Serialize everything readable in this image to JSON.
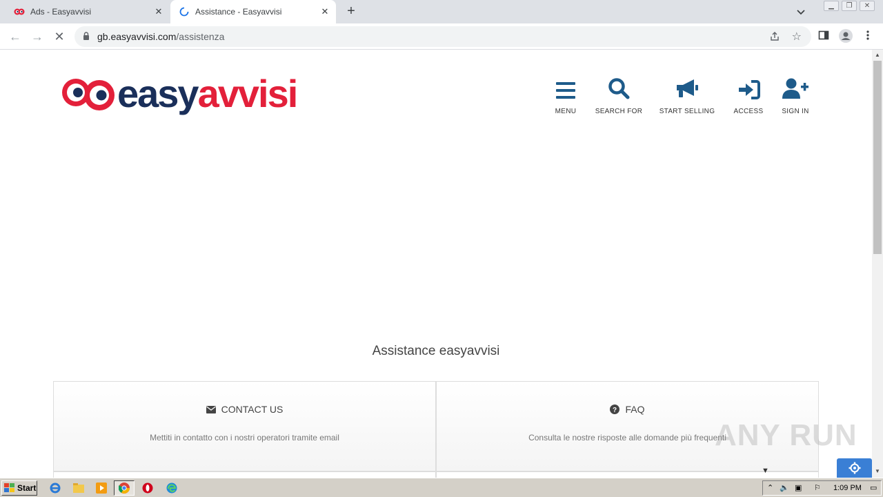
{
  "browser": {
    "tabs": [
      {
        "title": "Ads - Easyavvisi",
        "active": false
      },
      {
        "title": "Assistance - Easyavvisi",
        "active": true
      }
    ],
    "new_tab_label": "+",
    "url_host": "gb.easyavvisi.com",
    "url_path": "/assistenza"
  },
  "site": {
    "logo": {
      "easy": "easy",
      "avvisi": "avvisi"
    },
    "nav": [
      {
        "label": "MENU",
        "icon": "bars-icon"
      },
      {
        "label": "SEARCH FOR",
        "icon": "search-icon"
      },
      {
        "label": "START SELLING",
        "icon": "megaphone-icon"
      },
      {
        "label": "ACCESS",
        "icon": "sign-in-icon"
      },
      {
        "label": "SIGN IN",
        "icon": "user-plus-icon"
      }
    ],
    "page_title": "Assistance easyavvisi",
    "cards": [
      {
        "title": "CONTACT US",
        "icon": "envelope-icon",
        "description": "Mettiti in contatto con i nostri operatori tramite email"
      },
      {
        "title": "FAQ",
        "icon": "question-circle-icon",
        "description": "Consulta le nostre risposte alle domande più frequenti"
      }
    ],
    "colors": {
      "brand_blue": "#1a2f5a",
      "brand_red": "#e3203a",
      "nav_icon": "#1e5b8a"
    }
  },
  "overlay": {
    "watermark": "ANY RUN"
  },
  "taskbar": {
    "start_label": "Start",
    "clock": "1:09 PM"
  }
}
